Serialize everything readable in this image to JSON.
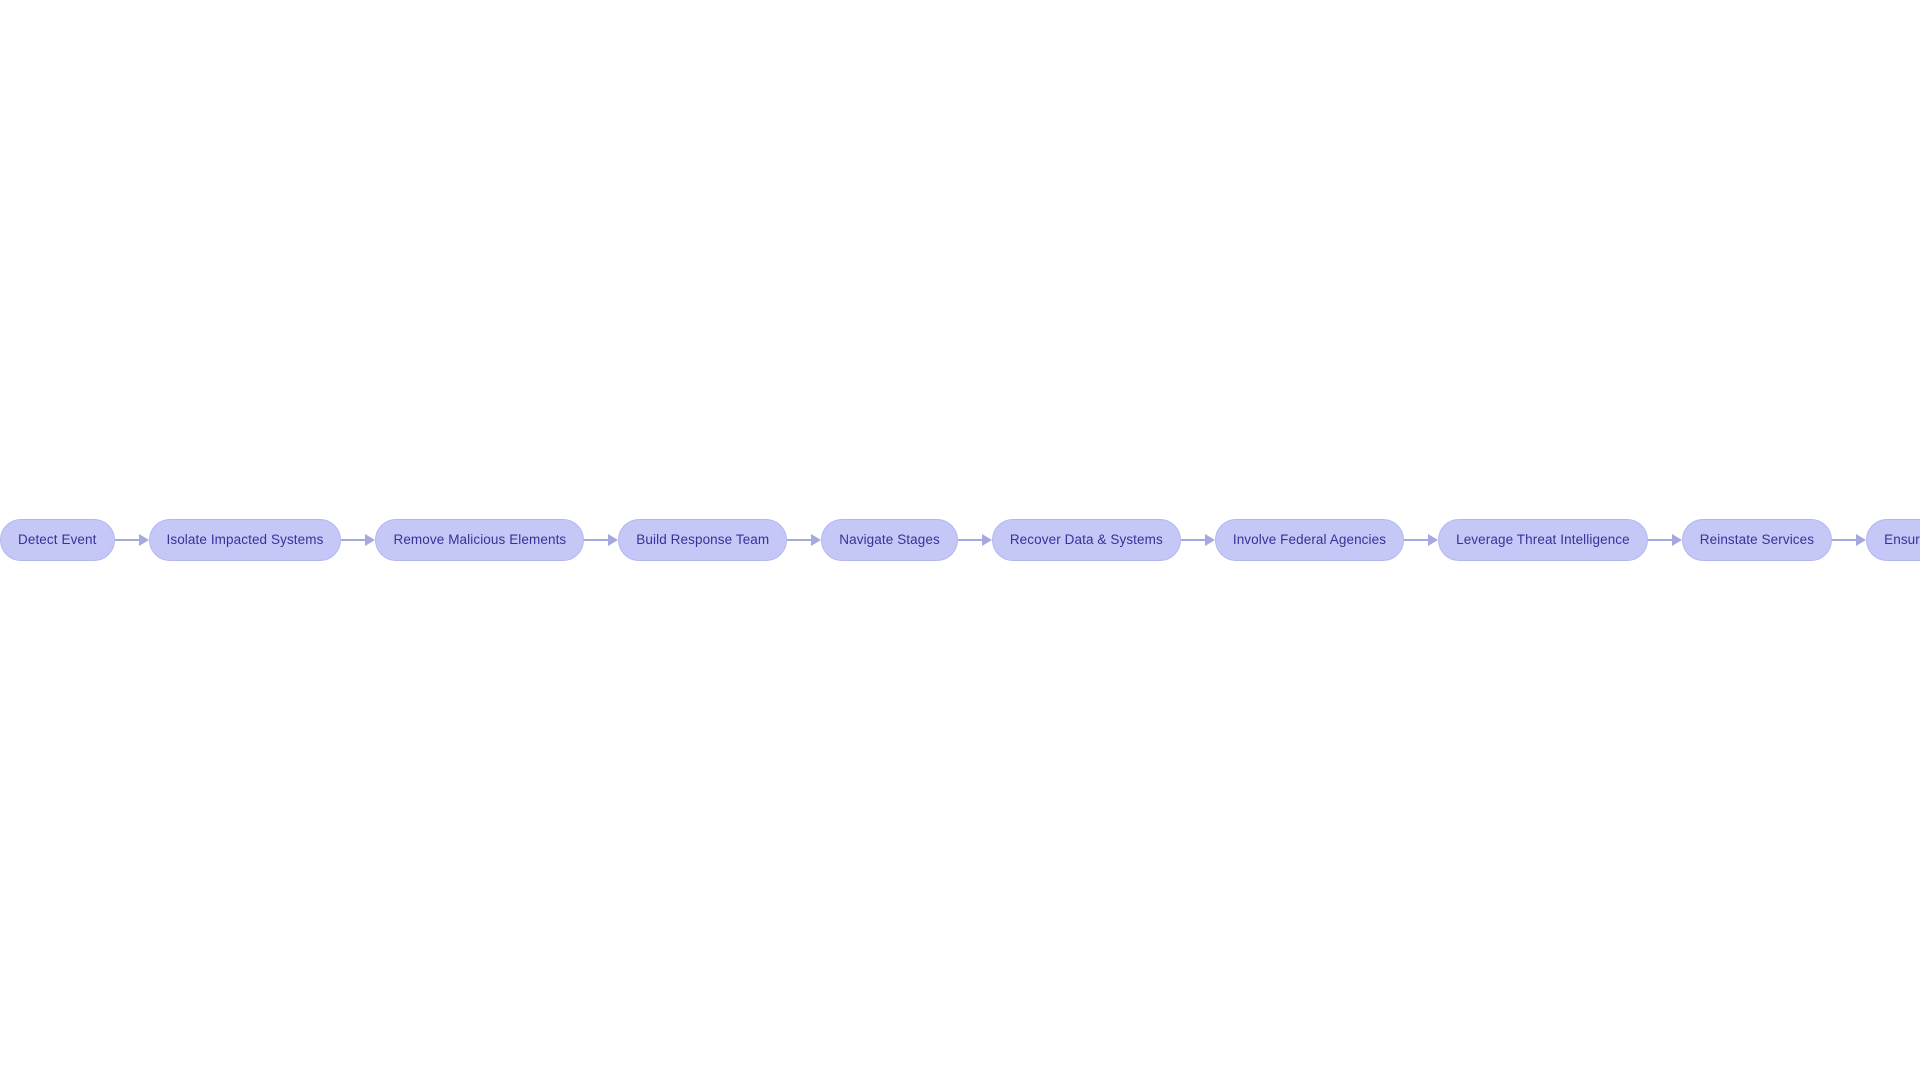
{
  "diagram": {
    "type": "flowchart",
    "orientation": "left-to-right",
    "title": "",
    "background_color": "#ffffff",
    "node_fill_color": "#c5c8f7",
    "node_border_color": "#b3b7f0",
    "node_text_color": "#333399",
    "connector_color": "#a5a9e0",
    "node_shape": "stadium",
    "node_count": 11,
    "edge_count": 10,
    "nodes": [
      {
        "id": "n1",
        "label": "Detect Event"
      },
      {
        "id": "n2",
        "label": "Isolate Impacted Systems"
      },
      {
        "id": "n3",
        "label": "Remove Malicious Elements"
      },
      {
        "id": "n4",
        "label": "Build Response Team"
      },
      {
        "id": "n5",
        "label": "Navigate Stages"
      },
      {
        "id": "n6",
        "label": "Recover Data & Systems"
      },
      {
        "id": "n7",
        "label": "Involve Federal Agencies"
      },
      {
        "id": "n8",
        "label": "Leverage Threat Intelligence"
      },
      {
        "id": "n9",
        "label": "Reinstate Services"
      },
      {
        "id": "n10",
        "label": "Ensure Future Resilience"
      }
    ],
    "edges": [
      {
        "from": "n1",
        "to": "n2",
        "label": "",
        "arrow": "arrow-right-icon"
      },
      {
        "from": "n2",
        "to": "n3",
        "label": "",
        "arrow": "arrow-right-icon"
      },
      {
        "from": "n3",
        "to": "n4",
        "label": "",
        "arrow": "arrow-right-icon"
      },
      {
        "from": "n4",
        "to": "n5",
        "label": "",
        "arrow": "arrow-right-icon"
      },
      {
        "from": "n5",
        "to": "n6",
        "label": "",
        "arrow": "arrow-right-icon"
      },
      {
        "from": "n6",
        "to": "n7",
        "label": "",
        "arrow": "arrow-right-icon"
      },
      {
        "from": "n7",
        "to": "n8",
        "label": "",
        "arrow": "arrow-right-icon"
      },
      {
        "from": "n8",
        "to": "n9",
        "label": "",
        "arrow": "arrow-right-icon"
      },
      {
        "from": "n9",
        "to": "n10",
        "label": "",
        "arrow": "arrow-right-icon"
      }
    ]
  }
}
